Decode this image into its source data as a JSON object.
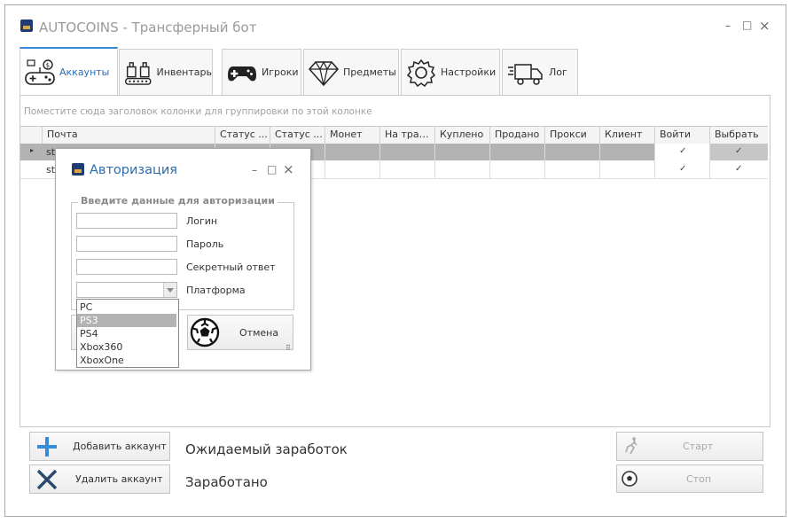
{
  "window": {
    "title": "AUTOCOINS - Трансферный бот",
    "minimize": "–",
    "maximize": "□",
    "close": "×"
  },
  "tabs": [
    {
      "label": "Аккаунты",
      "icon": "gamepad-icon",
      "active": true
    },
    {
      "label": "Инвентарь",
      "icon": "inventory-icon",
      "active": false
    },
    {
      "label": "Игроки",
      "icon": "controller-icon",
      "active": false
    },
    {
      "label": "Предметы",
      "icon": "diamond-icon",
      "active": false
    },
    {
      "label": "Настройки",
      "icon": "gear-icon",
      "active": false
    },
    {
      "label": "Лог",
      "icon": "truck-icon",
      "active": false
    }
  ],
  "grid": {
    "group_hint": "Поместите сюда заголовок колонки для группировки по этой колонке",
    "columns": [
      "Почта",
      "Статус ...",
      "Статус ...",
      "Монет",
      "На тран...",
      "Куплено",
      "Продано",
      "Прокси",
      "Клиент",
      "Войти",
      "Выбрать"
    ],
    "rows": [
      {
        "email": "st",
        "login": "✓",
        "select": "✓",
        "current": true
      },
      {
        "email": "st",
        "login": "✓",
        "select": "✓",
        "current": false
      }
    ]
  },
  "dialog": {
    "title": "Авторизация",
    "minimize": "–",
    "maximize": "□",
    "close": "×",
    "group_title": "Введите данные для авторизации",
    "fields": {
      "login": {
        "label": "Логин",
        "value": ""
      },
      "password": {
        "label": "Пароль",
        "value": ""
      },
      "secret": {
        "label": "Секретный ответ",
        "value": ""
      },
      "platform": {
        "label": "Платформа",
        "value": ""
      }
    },
    "platform_options": [
      "PC",
      "PS3",
      "PS4",
      "Xbox360",
      "XboxOne"
    ],
    "highlighted_option": "PS3",
    "cancel_label": "Отмена"
  },
  "footer": {
    "add_account": "Добавить аккаунт",
    "remove_account": "Удалить аккаунт",
    "expected_earnings": "Ожидаемый заработок",
    "earned": "Заработано",
    "start": "Старт",
    "stop": "Стоп"
  },
  "colors": {
    "accent": "#2a6db0",
    "selected_row": "#b3b3b3",
    "add_icon": "#3a8ad8",
    "remove_icon": "#2b4a6e"
  }
}
